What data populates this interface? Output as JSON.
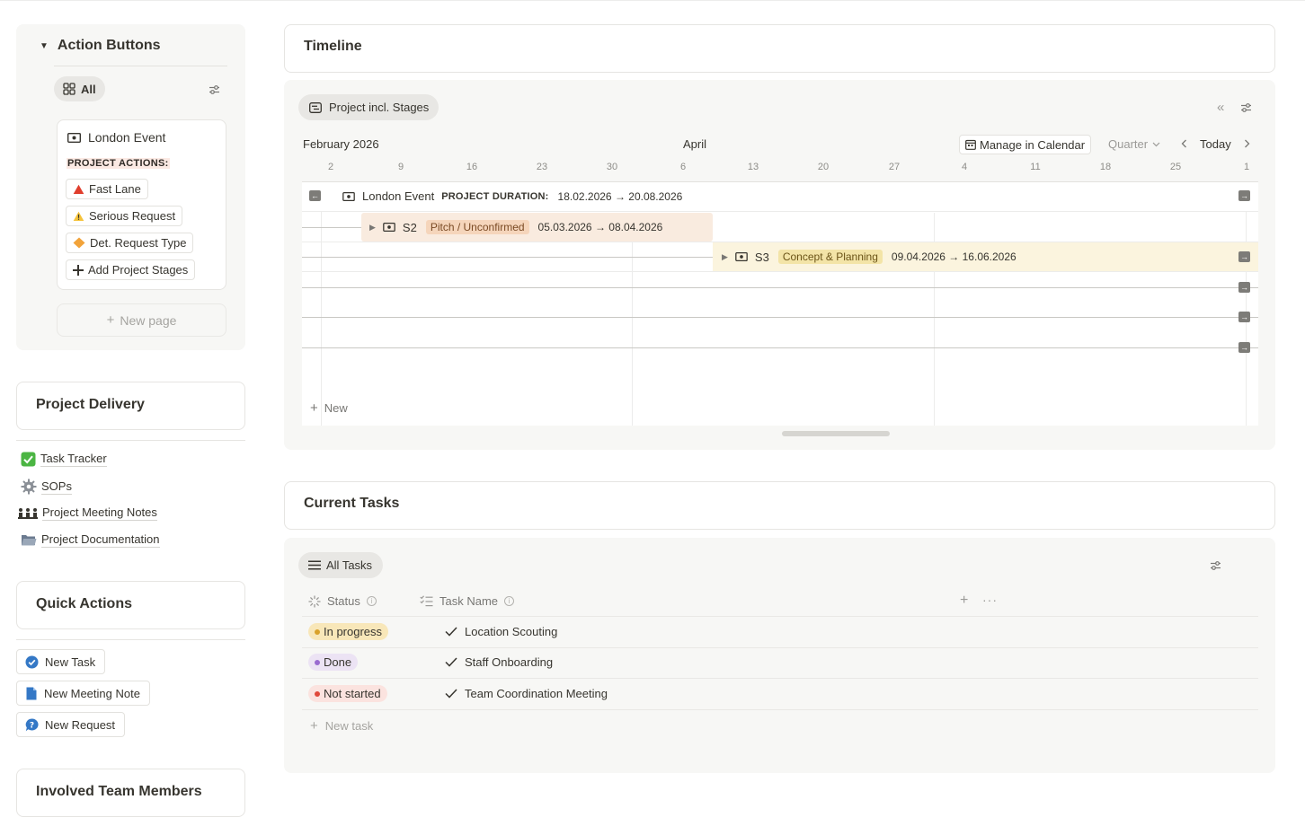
{
  "action_buttons": {
    "title": "Action Buttons",
    "view_label": "All",
    "card_title": "London Event",
    "project_actions_label": "PROJECT ACTIONS:",
    "buttons": [
      {
        "label": "Fast Lane",
        "icon": "red-triangle-icon"
      },
      {
        "label": "Serious Request",
        "icon": "warning-icon"
      },
      {
        "label": "Det. Request Type",
        "icon": "orange-diamond-icon"
      },
      {
        "label": "Add Project Stages",
        "icon": "plus-icon"
      }
    ],
    "new_page_label": "New page"
  },
  "project_delivery": {
    "title": "Project Delivery",
    "links": [
      {
        "label": "Task Tracker",
        "icon": "check-box-icon"
      },
      {
        "label": "SOPs",
        "icon": "gear-icon"
      },
      {
        "label": "Project Meeting Notes",
        "icon": "people-icon"
      },
      {
        "label": "Project Documentation",
        "icon": "folder-icon"
      }
    ]
  },
  "quick_actions": {
    "title": "Quick Actions",
    "buttons": [
      {
        "label": "New Task",
        "icon": "check-circle-icon"
      },
      {
        "label": "New Meeting Note",
        "icon": "document-icon"
      },
      {
        "label": "New Request",
        "icon": "question-bubble-icon"
      }
    ]
  },
  "involved_team": {
    "title": "Involved Team Members"
  },
  "timeline": {
    "title": "Timeline",
    "view_label": "Project incl. Stages",
    "months": [
      {
        "label": "February 2026"
      },
      {
        "label": "April"
      }
    ],
    "ticks": [
      "2",
      "9",
      "16",
      "23",
      "30",
      "6",
      "13",
      "20",
      "27",
      "4",
      "11",
      "18",
      "25",
      "1"
    ],
    "manage_calendar_label": "Manage in Calendar",
    "range_label": "Quarter",
    "today_label": "Today",
    "project_row": {
      "name": "London Event",
      "duration_label": "PROJECT DURATION:",
      "dates": "18.02.2026 → 20.08.2026"
    },
    "stages": [
      {
        "id": "S2",
        "status": "Pitch / Unconfirmed",
        "dates": "05.03.2026 → 08.04.2026",
        "color": "#f9ebdf",
        "tag_color": "#f5d5bb"
      },
      {
        "id": "S3",
        "status": "Concept & Planning",
        "dates": "09.04.2026 → 16.06.2026",
        "color": "#fbf4de",
        "tag_color": "#f3e4a7"
      }
    ],
    "new_label": "New"
  },
  "current_tasks": {
    "title": "Current Tasks",
    "view_label": "All Tasks",
    "columns": {
      "status": "Status",
      "task_name": "Task Name"
    },
    "rows": [
      {
        "status": "In progress",
        "status_bg": "#f8e7b9",
        "dot": "#d9a22b",
        "name": "Location Scouting"
      },
      {
        "status": "Done",
        "status_bg": "#ece3f4",
        "dot": "#9a6bd0",
        "name": "Staff Onboarding"
      },
      {
        "status": "Not started",
        "status_bg": "#fbe3df",
        "dot": "#e0493b",
        "name": "Team Coordination Meeting"
      }
    ],
    "new_task_label": "New task"
  }
}
